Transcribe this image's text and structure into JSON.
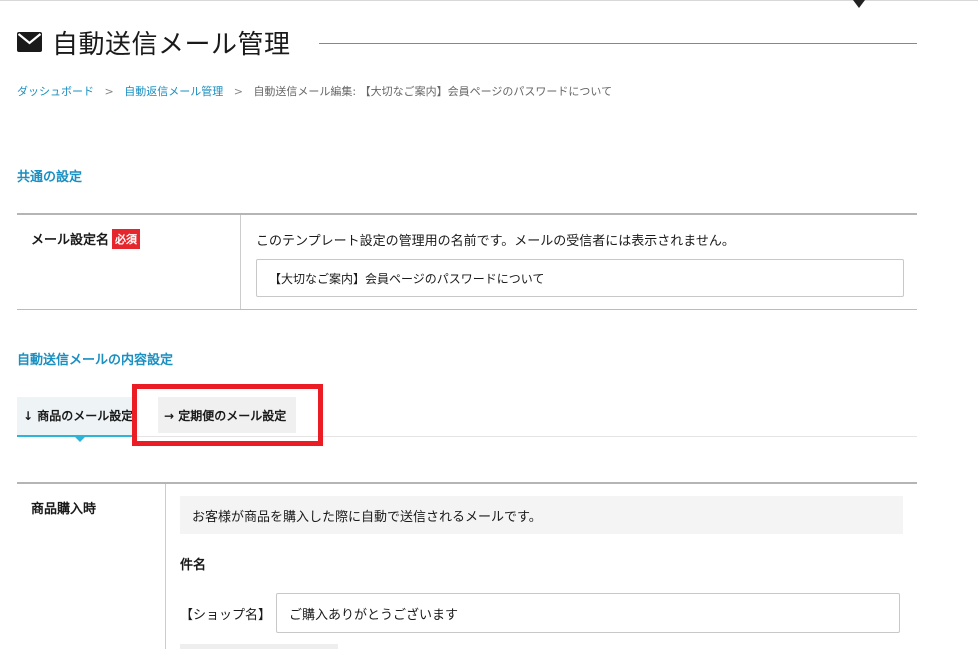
{
  "header": {
    "title": "自動送信メール管理",
    "icon": "envelope-icon"
  },
  "breadcrumb": {
    "items": [
      {
        "label": "ダッシュボード",
        "link": true
      },
      {
        "label": "自動返信メール管理",
        "link": true
      },
      {
        "label": "自動送信メール編集: 【大切なご案内】会員ページのパスワードについて",
        "link": false
      }
    ],
    "separator": ">"
  },
  "common_settings": {
    "heading": "共通の設定",
    "mail_name_label": "メール設定名",
    "required_badge": "必須",
    "help_text": "このテンプレート設定の管理用の名前です。メールの受信者には表示されません。",
    "mail_name_value": "【大切なご案内】会員ページのパスワードについて"
  },
  "content_settings": {
    "heading": "自動送信メールの内容設定",
    "tabs": [
      {
        "label": "↓ 商品のメール設定",
        "active": true
      },
      {
        "label": "→ 定期便のメール設定",
        "active": false
      }
    ]
  },
  "purchase_mail": {
    "label": "商品購入時",
    "description": "お客様が商品を購入した際に自動で送信されるメールです。",
    "subject_label": "件名",
    "shop_prefix": "【ショップ名】",
    "subject_value": "ご購入ありがとうございます"
  },
  "colors": {
    "accent": "#1a8fc2",
    "required": "#e5272d",
    "highlight": "#ec1c24",
    "tab_underline": "#2bb5d8"
  }
}
